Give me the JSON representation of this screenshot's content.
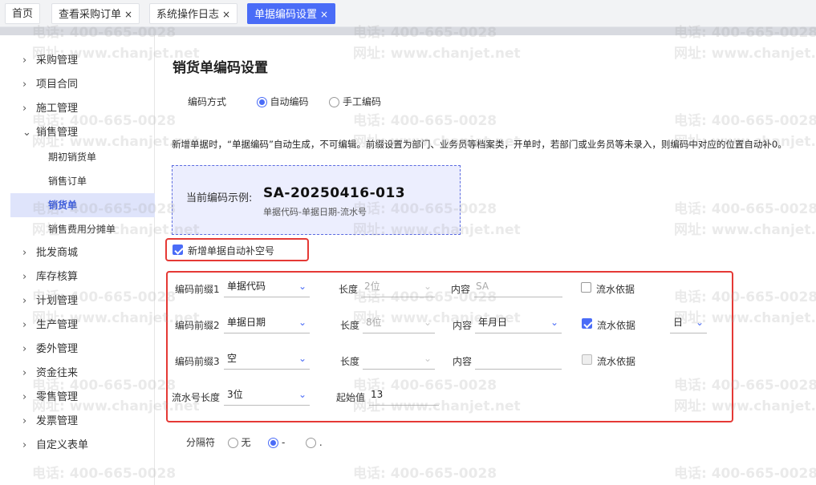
{
  "tabs": [
    {
      "label": "首页",
      "closable": false,
      "active": false
    },
    {
      "label": "查看采购订单",
      "closable": true,
      "active": false
    },
    {
      "label": "系统操作日志",
      "closable": true,
      "active": false
    },
    {
      "label": "单据编码设置",
      "closable": true,
      "active": true
    }
  ],
  "tab_close_glyph": "×",
  "sidebar": {
    "items": [
      {
        "label": "采购管理",
        "expanded": false
      },
      {
        "label": "项目合同",
        "expanded": false
      },
      {
        "label": "施工管理",
        "expanded": false
      },
      {
        "label": "销售管理",
        "expanded": true
      },
      {
        "label": "批发商城",
        "expanded": false
      },
      {
        "label": "库存核算",
        "expanded": false
      },
      {
        "label": "计划管理",
        "expanded": false
      },
      {
        "label": "生产管理",
        "expanded": false
      },
      {
        "label": "委外管理",
        "expanded": false
      },
      {
        "label": "资金往来",
        "expanded": false
      },
      {
        "label": "零售管理",
        "expanded": false
      },
      {
        "label": "发票管理",
        "expanded": false
      },
      {
        "label": "自定义表单",
        "expanded": false
      }
    ],
    "sales_children": [
      {
        "label": "期初销货单",
        "active": false
      },
      {
        "label": "销售订单",
        "active": false
      },
      {
        "label": "销货单",
        "active": true
      },
      {
        "label": "销售费用分摊单",
        "active": false
      }
    ]
  },
  "main": {
    "title": "销货单编码设置",
    "mode": {
      "label": "编码方式",
      "options": [
        {
          "label": "自动编码",
          "selected": true
        },
        {
          "label": "手工编码",
          "selected": false
        }
      ]
    },
    "description": "新增单据时，“单据编码”自动生成，不可编辑。前缀设置为部门、业务员等档案类，开单时，若部门或业务员等未录入，则编码中对应的位置自动补0。",
    "example": {
      "label": "当前编码示例:",
      "value": "SA-20250416-013",
      "format": "单据代码-单据日期-流水号"
    },
    "autofill": {
      "label": "新增单据自动补空号",
      "checked": true
    },
    "prefixes": [
      {
        "label": "编码前缀1",
        "value": "单据代码",
        "length_label": "长度",
        "length_value": "2位",
        "content_label": "内容",
        "content_value": "SA",
        "serial_label": "流水依据",
        "serial_checked": false,
        "serial_disabled": false
      },
      {
        "label": "编码前缀2",
        "value": "单据日期",
        "length_label": "长度",
        "length_value": "8位",
        "content_label": "内容",
        "content_value": "年月日",
        "serial_label": "流水依据",
        "serial_checked": true,
        "serial_disabled": false,
        "serial_unit": "日"
      },
      {
        "label": "编码前缀3",
        "value": "空",
        "length_label": "长度",
        "length_value": "",
        "content_label": "内容",
        "content_value": "",
        "serial_label": "流水依据",
        "serial_checked": false,
        "serial_disabled": true
      }
    ],
    "serial": {
      "length_label": "流水号长度",
      "length_value": "3位",
      "start_label": "起始值",
      "start_value": "13"
    },
    "separator": {
      "label": "分隔符",
      "options": [
        {
          "label": "无",
          "selected": false
        },
        {
          "label": "-",
          "selected": true
        },
        {
          "label": ".",
          "selected": false
        }
      ]
    }
  },
  "watermark": {
    "phone": "电话: 400-665-0028",
    "site": "网址: www.chanjet.net"
  },
  "colors": {
    "accent": "#4a6cf7",
    "highlight_border": "#e53935",
    "sidebar_active_bg": "#dfe4fb"
  },
  "icons": {
    "expand": "chevron-right-icon",
    "collapse": "chevron-down-icon",
    "dropdown": "chevron-down-icon"
  }
}
